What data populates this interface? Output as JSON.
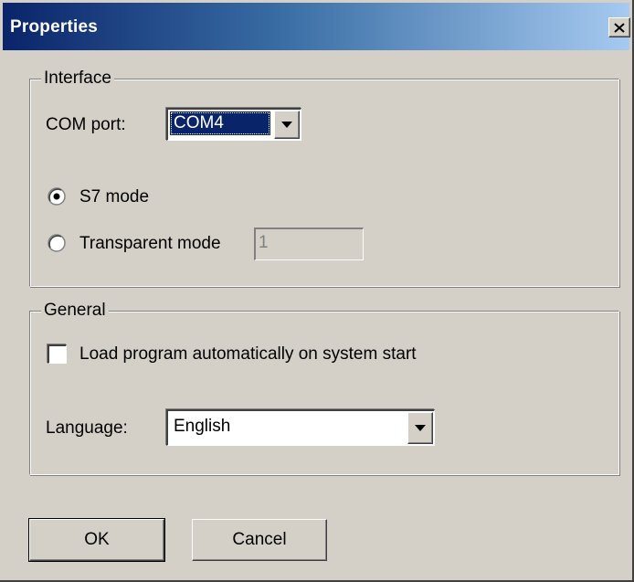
{
  "window": {
    "title": "Properties",
    "close_icon": "close-icon"
  },
  "interface": {
    "group_label": "Interface",
    "com_port_label": "COM port:",
    "com_port_value": "COM4",
    "s7_mode_label": "S7 mode",
    "s7_mode_selected": true,
    "transparent_mode_label": "Transparent mode",
    "transparent_mode_selected": false,
    "transparent_mode_value": "1"
  },
  "general": {
    "group_label": "General",
    "autoload_label": "Load program automatically on system start",
    "autoload_checked": false,
    "language_label": "Language:",
    "language_value": "English"
  },
  "buttons": {
    "ok_label": "OK",
    "cancel_label": "Cancel"
  },
  "colors": {
    "titlebar_start": "#0a246a",
    "titlebar_end": "#a6caf0",
    "face": "#d4d0c8",
    "selection": "#0a246a"
  }
}
